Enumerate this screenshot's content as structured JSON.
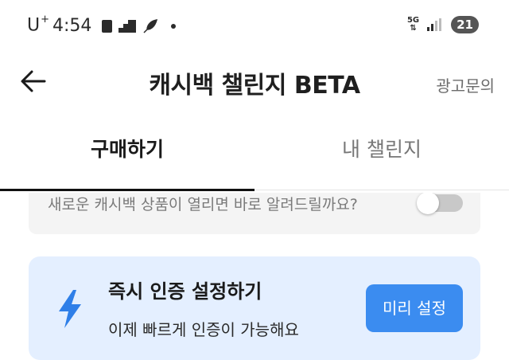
{
  "status_bar": {
    "carrier": "U",
    "carrier_sup": "+",
    "time": "4:54",
    "network": "5G",
    "battery": "21"
  },
  "header": {
    "title": "캐시백 챌린지 BETA",
    "ad_link": "광고문의"
  },
  "tabs": [
    {
      "label": "구매하기",
      "active": true
    },
    {
      "label": "내 챌린지",
      "active": false
    }
  ],
  "notify": {
    "text": "새로운 캐시백 상품이 열리면 바로 알려드릴까요?",
    "toggle_on": false
  },
  "instant_auth": {
    "title": "즉시 인증 설정하기",
    "subtitle": "이제 빠르게 인증이 가능해요",
    "button_label": "미리 설정"
  },
  "colors": {
    "accent": "#3b8cf0",
    "card_bg": "#e4efff",
    "notify_bg": "#f4f4f4"
  }
}
